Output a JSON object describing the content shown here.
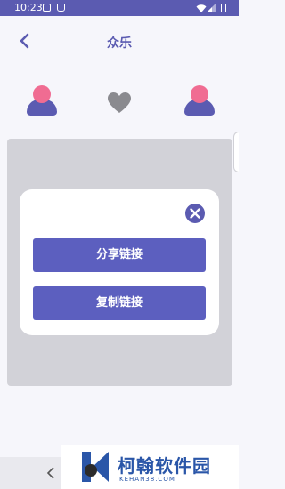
{
  "status_bar": {
    "time": "10:23"
  },
  "header": {
    "title": "众乐"
  },
  "dialog": {
    "share_label": "分享链接",
    "copy_label": "复制链接"
  },
  "watermark": {
    "name": "柯翰软件园",
    "url": "KEHAN38.COM"
  },
  "colors": {
    "accent": "#5b5bb1",
    "avatar_head": "#f06c92",
    "overlay": "#d2d2d8"
  },
  "icons": [
    "image-icon",
    "bag-icon",
    "wifi-icon",
    "signal-icon",
    "battery-icon",
    "back-arrow-icon",
    "avatar-icon",
    "heart-icon",
    "close-icon",
    "nav-back-icon",
    "logo-icon"
  ]
}
